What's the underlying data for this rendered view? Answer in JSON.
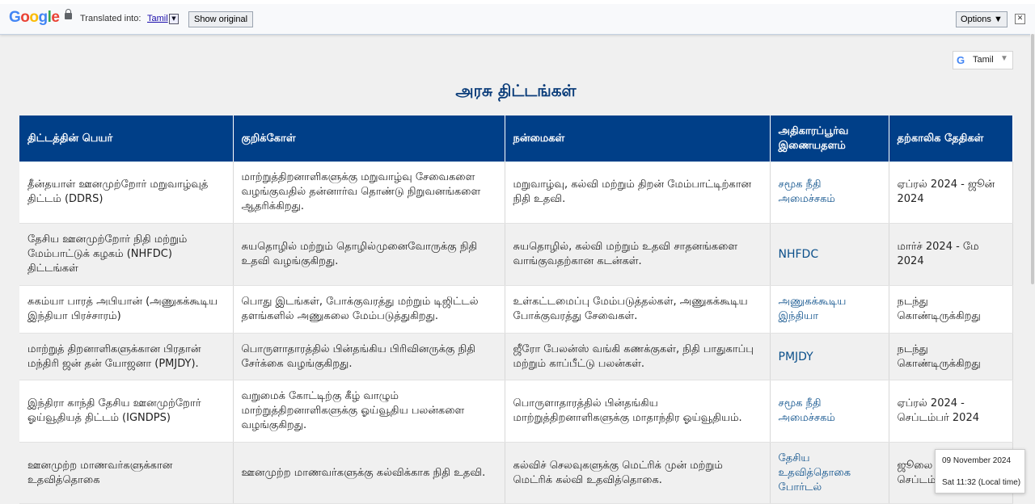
{
  "translate_bar": {
    "logo_letters": [
      "G",
      "o",
      "o",
      "g",
      "l",
      "e"
    ],
    "logo_colors": [
      "#4285f4",
      "#ea4335",
      "#fbbc05",
      "#4285f4",
      "#34a853",
      "#ea4335"
    ],
    "translated_into": "Translated into:",
    "language": "Tamil",
    "show_original": "Show original",
    "options": "Options ▼",
    "close": "✕"
  },
  "language_widget": {
    "label": "Tamil",
    "g": "G",
    "dropdown": "▼"
  },
  "page_title": "அரசு திட்டங்கள்",
  "table": {
    "headers": [
      "திட்டத்தின் பெயர்",
      "குறிக்கோள்",
      "நன்மைகள்",
      "அதிகாரப்பூர்வ இணையதளம்",
      "தற்காலிக தேதிகள்"
    ],
    "rows": [
      [
        "தீன்தயாள் ஊனமுற்றோர் மறுவாழ்வுத் திட்டம் (DDRS)",
        "மாற்றுத்திறனாளிகளுக்கு மறுவாழ்வு சேவைகளை வழங்குவதில் தன்னார்வ தொண்டு நிறுவனங்களை ஆதரிக்கிறது.",
        "மறுவாழ்வு, கல்வி மற்றும் திறன் மேம்பாட்டிற்கான நிதி உதவி.",
        "சமூக நீதி அமைச்சகம்",
        "ஏப்ரல் 2024 - ஜூன் 2024"
      ],
      [
        "தேசிய ஊனமுற்றோர் நிதி மற்றும் மேம்பாட்டுக் கழகம் (NHFDC) திட்டங்கள்",
        "சுயதொழில் மற்றும் தொழில்முனைவோருக்கு நிதி உதவி வழங்குகிறது.",
        "சுயதொழில், கல்வி மற்றும் உதவி சாதனங்களை வாங்குவதற்கான கடன்கள்.",
        "NHFDC",
        "மார்ச் 2024 - மே 2024"
      ],
      [
        "சுகம்யா பாரத் அபியான் (அணுகக்கூடிய இந்தியா பிரச்சாரம்)",
        "பொது இடங்கள், போக்குவரத்து மற்றும் டிஜிட்டல் தளங்களில் அணுகலை மேம்படுத்துகிறது.",
        "உள்கட்டமைப்பு மேம்படுத்தல்கள், அணுகக்கூடிய போக்குவரத்து சேவைகள்.",
        "அணுகக்கூடிய இந்தியா",
        "நடந்து கொண்டிருக்கிறது"
      ],
      [
        "மாற்றுத் திறனாளிகளுக்கான பிரதான் மந்திரி ஜன் தன் யோஜனா (PMJDY).",
        "பொருளாதாரத்தில் பின்தங்கிய பிரிவினருக்கு நிதி சேர்க்கை வழங்குகிறது.",
        "ஜீரோ பேலன்ஸ் வங்கி கணக்குகள், நிதி பாதுகாப்பு மற்றும் காப்பீட்டு பலன்கள்.",
        "PMJDY",
        "நடந்து கொண்டிருக்கிறது"
      ],
      [
        "இந்திரா காந்தி தேசிய ஊனமுற்றோர் ஓய்வூதியத் திட்டம் (IGNDPS)",
        "வறுமைக் கோட்டிற்கு கீழ் வாழும் மாற்றுத்திறனாளிகளுக்கு ஓய்வூதிய பலன்களை வழங்குகிறது.",
        "பொருளாதாரத்தில் பின்தங்கிய மாற்றுத்திறனாளிகளுக்கு மாதாந்திர ஓய்வூதியம்.",
        "சமூக நீதி அமைச்சகம்",
        "ஏப்ரல் 2024 - செப்டம்பர் 2024"
      ],
      [
        "ஊனமுற்ற மாணவர்களுக்கான உதவித்தொகை",
        "ஊனமுற்ற மாணவர்களுக்கு கல்விக்காக நிதி உதவி.",
        "கல்விச் செலவுகளுக்கு மெட்ரிக் முன் மற்றும் மெட்ரிக் கல்வி உதவித்தொகை.",
        "தேசிய உதவித்தொகை போர்டல்",
        "ஜூலை 2024 - செப்டம்பர் 2024"
      ]
    ]
  },
  "clock": {
    "date": "09 November 2024",
    "time": "Sat 11:32 (Local time)"
  }
}
